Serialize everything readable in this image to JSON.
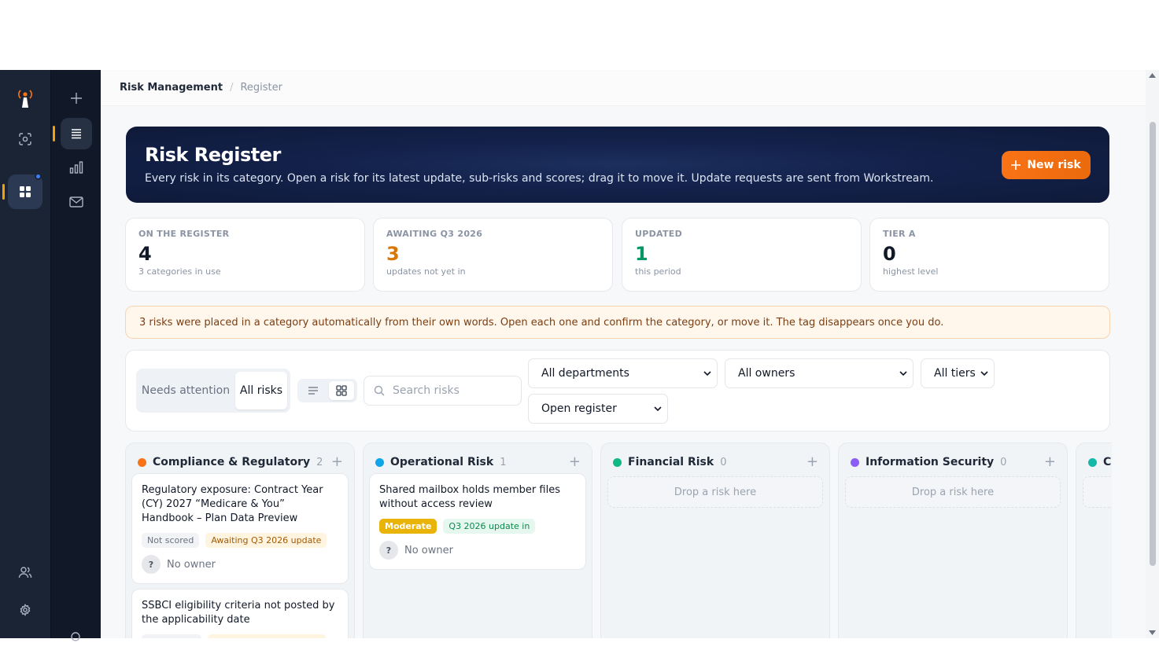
{
  "breadcrumb": {
    "section": "Risk Management",
    "separator": "/",
    "page": "Register"
  },
  "hero": {
    "title": "Risk Register",
    "subtitle": "Every risk in its category. Open a risk for its latest update, sub-risks and scores; drag it to move it. Update requests are sent from Workstream.",
    "new_button": "New risk"
  },
  "stats": [
    {
      "label": "ON THE REGISTER",
      "value": "4",
      "sub": "3 categories in use",
      "color": "#111827"
    },
    {
      "label": "AWAITING Q3 2026",
      "value": "3",
      "sub": "updates not yet in",
      "color": "#d97706"
    },
    {
      "label": "UPDATED",
      "value": "1",
      "sub": "this period",
      "color": "#059669"
    },
    {
      "label": "TIER A",
      "value": "0",
      "sub": "highest level",
      "color": "#111827"
    }
  ],
  "notice": "3 risks were placed in a category automatically from their own words. Open each one and confirm the category, or move it. The tag disappears once you do.",
  "toolbar": {
    "segment_a": "Needs attention",
    "segment_b": "All risks",
    "search_placeholder": "Search risks",
    "departments": "All departments",
    "owners": "All owners",
    "tiers": "All tiers",
    "status": "Open register"
  },
  "columns": [
    {
      "title": "Compliance & Regulatory",
      "count": "2",
      "color": "#f97316"
    },
    {
      "title": "Operational Risk",
      "count": "1",
      "color": "#0ea5e9"
    },
    {
      "title": "Financial Risk",
      "count": "0",
      "color": "#10b981",
      "empty": "Drop a risk here"
    },
    {
      "title": "Information Security",
      "count": "0",
      "color": "#8b5cf6",
      "empty": "Drop a risk here"
    },
    {
      "title": "Cl",
      "color": "#14b8a6"
    }
  ],
  "cards": [
    {
      "title": "Regulatory exposure: Contract Year (CY) 2027 “Medicare & You” Handbook – Plan Data Preview",
      "tag1": "Not scored",
      "tag2": "Awaiting Q3 2026 update",
      "owner_initial": "?",
      "owner": "No owner"
    },
    {
      "title": "SSBCI eligibility criteria not posted by the applicability date"
    },
    {
      "title": "Shared mailbox holds member files without access review",
      "tag1": "Moderate",
      "tag2": "Q3 2026 update in",
      "owner_initial": "?",
      "owner": "No owner"
    }
  ]
}
